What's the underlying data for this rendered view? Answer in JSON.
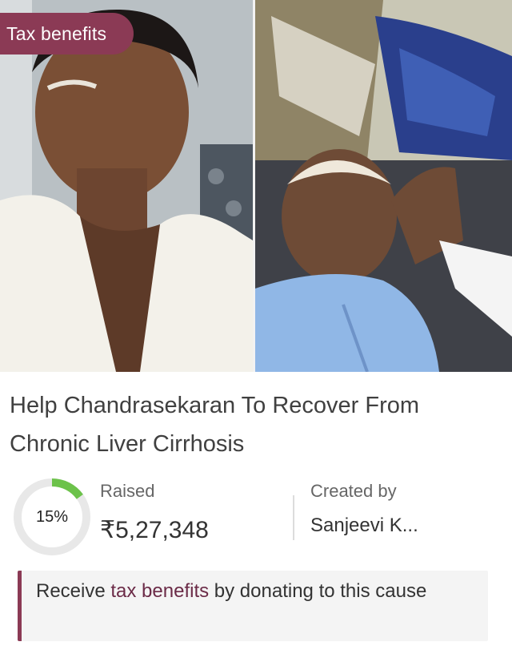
{
  "badge": {
    "label": "Tax benefits"
  },
  "campaign": {
    "title": "Help Chandrasekaran To Recover From Chronic Liver Cirrhosis"
  },
  "progress": {
    "percent_label": "15%",
    "fraction": 0.15
  },
  "raised": {
    "label": "Raised",
    "amount": "₹5,27,348"
  },
  "creator": {
    "label": "Created by",
    "name": "Sanjeevi K..."
  },
  "tax_notice": {
    "prefix": "Receive ",
    "link": "tax benefits",
    "suffix": " by donating to this cause"
  },
  "colors": {
    "accent": "#8b3a55",
    "progress": "#6cc24a",
    "track": "#e8e8e8"
  },
  "images": {
    "left": "person-portrait-white-shawl",
    "right": "patient-lying-on-hospital-bed"
  }
}
